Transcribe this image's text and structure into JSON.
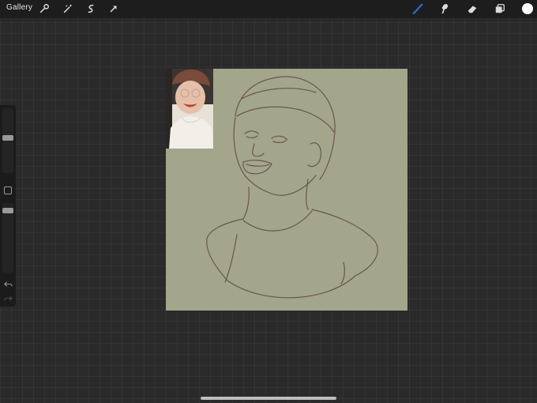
{
  "topbar": {
    "gallery_label": "Gallery",
    "left_tools": [
      "wrench-icon",
      "magic-wand-icon",
      "selection-icon",
      "transform-arrow-icon"
    ],
    "right_tools": [
      "brush-icon",
      "smudge-icon",
      "eraser-icon",
      "layers-icon"
    ],
    "active_tool": "brush-icon",
    "accent_color": "#2f6bd8",
    "current_color": "#ffffff"
  },
  "sidebar": {
    "controls": [
      "brush-size-slider",
      "modify-button",
      "opacity-slider",
      "undo-icon",
      "redo-icon"
    ]
  },
  "canvas": {
    "background_color": "#a3a68a",
    "sketch_color": "#6a5550"
  }
}
